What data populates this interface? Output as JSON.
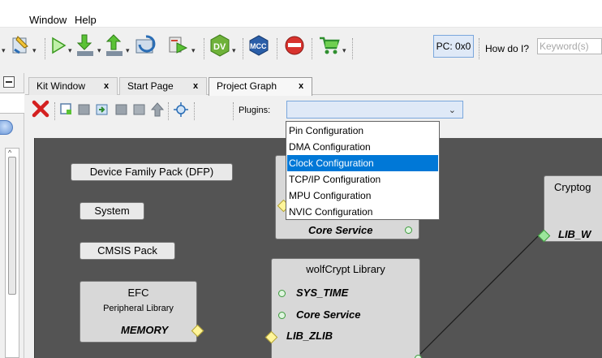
{
  "menu": {
    "items": [
      "Window",
      "Help"
    ]
  },
  "toolbar": {
    "icons": [
      "wizard-icon",
      "run-icon",
      "download-icon",
      "upload-icon",
      "refresh-icon",
      "project-icon",
      "data-visualizer-icon",
      "mcc-icon",
      "discover-icon",
      "cart-icon"
    ],
    "pc_label": "PC: 0x0",
    "how_do_i_label": "How do I?",
    "keyword_placeholder": "Keyword(s)"
  },
  "tabs": [
    {
      "label": "Kit Window",
      "close": "x",
      "active": false
    },
    {
      "label": "Start Page",
      "close": "x",
      "active": false
    },
    {
      "label": "Project Graph",
      "close": "x",
      "active": true
    }
  ],
  "graph_toolbar": {
    "icons": [
      "delete-icon",
      "new-node-icon",
      "node-grey-icon",
      "node-import-icon",
      "node-grey-2-icon",
      "node-grey-3-icon",
      "arrow-up-icon",
      "fit-icon"
    ],
    "plugins_label": "Plugins:",
    "plugins_value": ""
  },
  "plugins_dropdown": {
    "options": [
      "Pin Configuration",
      "DMA Configuration",
      "Clock Configuration",
      "TCP/IP Configuration",
      "MPU Configuration",
      "NVIC Configuration"
    ],
    "selected_index": 2
  },
  "graph": {
    "dfp_label": "Device Family Pack (DFP)",
    "system_label": "System",
    "cmsis_label": "CMSIS Pack",
    "efc": {
      "title": "EFC",
      "subtitle": "Peripheral Library",
      "port": "MEMORY"
    },
    "hidden_box": {
      "port": "Core Service"
    },
    "wolfcrypt": {
      "title": "wolfCrypt Library",
      "ports": [
        "SYS_TIME",
        "Core Service",
        "LIB_ZLIB"
      ]
    },
    "crypto": {
      "title": "Cryptog",
      "port": "LIB_W"
    }
  },
  "colors": {
    "canvas_bg": "#545454",
    "node_bg": "#d8d8d8",
    "selected_bg": "#0078d7",
    "combo_bg": "#dfe9f7",
    "dependency_green": "#3c9a3c",
    "capability_yellow": "#fff59a"
  }
}
